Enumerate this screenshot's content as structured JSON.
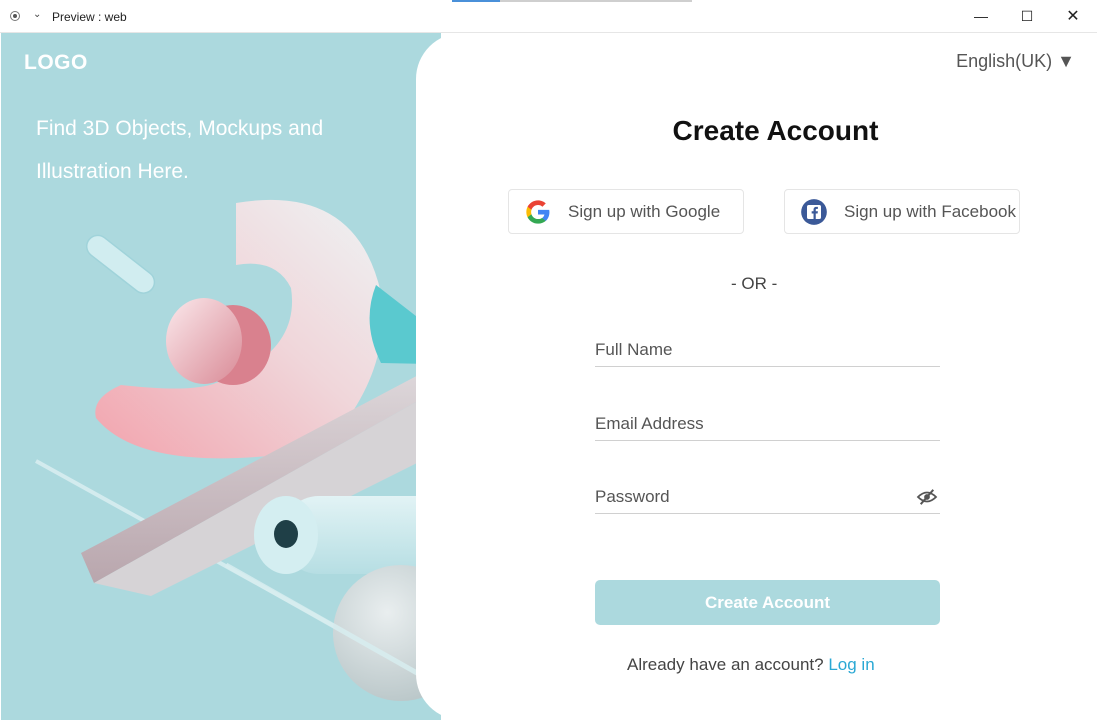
{
  "window": {
    "title": "Preview : web",
    "chevron_glyph": "⌄",
    "minimize_glyph": "—",
    "maximize_glyph": "☐",
    "close_glyph": "✕"
  },
  "left": {
    "logo": "LOGO",
    "tagline": "Find 3D Objects, Mockups and Illustration Here.",
    "background_color": "#acd9de"
  },
  "header": {
    "language": "English(UK) ▼"
  },
  "form": {
    "title": "Create Account",
    "google_label": "Sign up with Google",
    "facebook_label": "Sign up with Facebook",
    "separator": "- OR -",
    "full_name_placeholder": "Full Name",
    "email_placeholder": "Email Address",
    "password_placeholder": "Password",
    "submit_label": "Create Account",
    "login_prompt": "Already have an account?",
    "login_link": "Log in",
    "accent_color": "#acd9de",
    "link_color": "#2aa8d4"
  }
}
